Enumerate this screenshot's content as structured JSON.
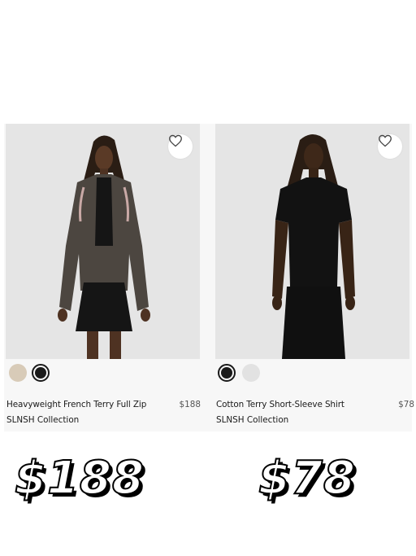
{
  "products": [
    {
      "name": "Heavyweight French Terry Full Zip",
      "collection": "SLNSH Collection",
      "price": "$188",
      "wishlist_icon": "heart-outline-icon",
      "swatches": [
        {
          "color": "#d8cbb8",
          "selected": false
        },
        {
          "color": "#1a1a1a",
          "selected": true
        }
      ]
    },
    {
      "name": "Cotton Terry Short-Sleeve Shirt",
      "collection": "SLNSH Collection",
      "price": "$78",
      "wishlist_icon": "heart-outline-icon",
      "swatches": [
        {
          "color": "#1a1a1a",
          "selected": true
        },
        {
          "color": "#e2e2e2",
          "selected": false
        }
      ]
    }
  ],
  "overlay_prices": [
    "$188",
    "$78"
  ]
}
